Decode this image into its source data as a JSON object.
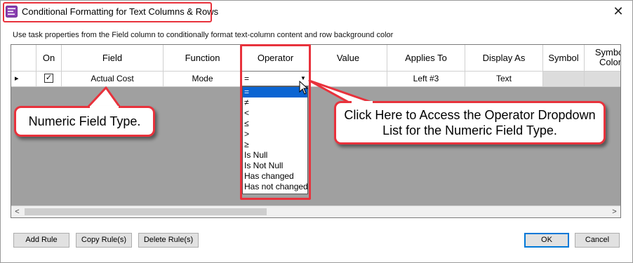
{
  "window": {
    "title": "Conditional Formatting for Text Columns & Rows",
    "close_glyph": "✕"
  },
  "instructions": "Use task properties from the Field column to conditionally format text-column content and row background color",
  "grid": {
    "columns": [
      "On",
      "Field",
      "Function",
      "Operator",
      "Value",
      "Applies To",
      "Display As",
      "Symbol",
      "Symbol Color"
    ],
    "row": {
      "selector_glyph": "▸",
      "on_checked": true,
      "check_glyph": "✓",
      "field": "Actual Cost",
      "function": "Mode",
      "operator": "=",
      "value": "",
      "applies_to": "Left #3",
      "display_as": "Text",
      "symbol": "",
      "symbol_color": ""
    },
    "scroll_left": "<",
    "scroll_right": ">"
  },
  "operator_dropdown": {
    "arrow_glyph": "▼",
    "selected": "=",
    "options": [
      "=",
      "≠",
      "<",
      "≤",
      ">",
      "≥",
      "Is Null",
      "Is Not Null",
      "Has changed",
      "Has not changed"
    ]
  },
  "callouts": {
    "field_type": "Numeric Field Type.",
    "operator_hint": "Click Here to Access the Operator Dropdown List for the Numeric Field Type."
  },
  "buttons": {
    "add_rule": "Add Rule",
    "copy_rules": "Copy Rule(s)",
    "delete_rules": "Delete Rule(s)",
    "ok": "OK",
    "cancel": "Cancel"
  },
  "colors": {
    "annotation_red": "#e8323c",
    "selection_blue": "#0a64d2",
    "grid_background": "#a0a0a0"
  },
  "icons": {
    "app": "conditional-formatting-icon",
    "close": "close-icon",
    "cursor": "mouse-pointer-icon"
  }
}
